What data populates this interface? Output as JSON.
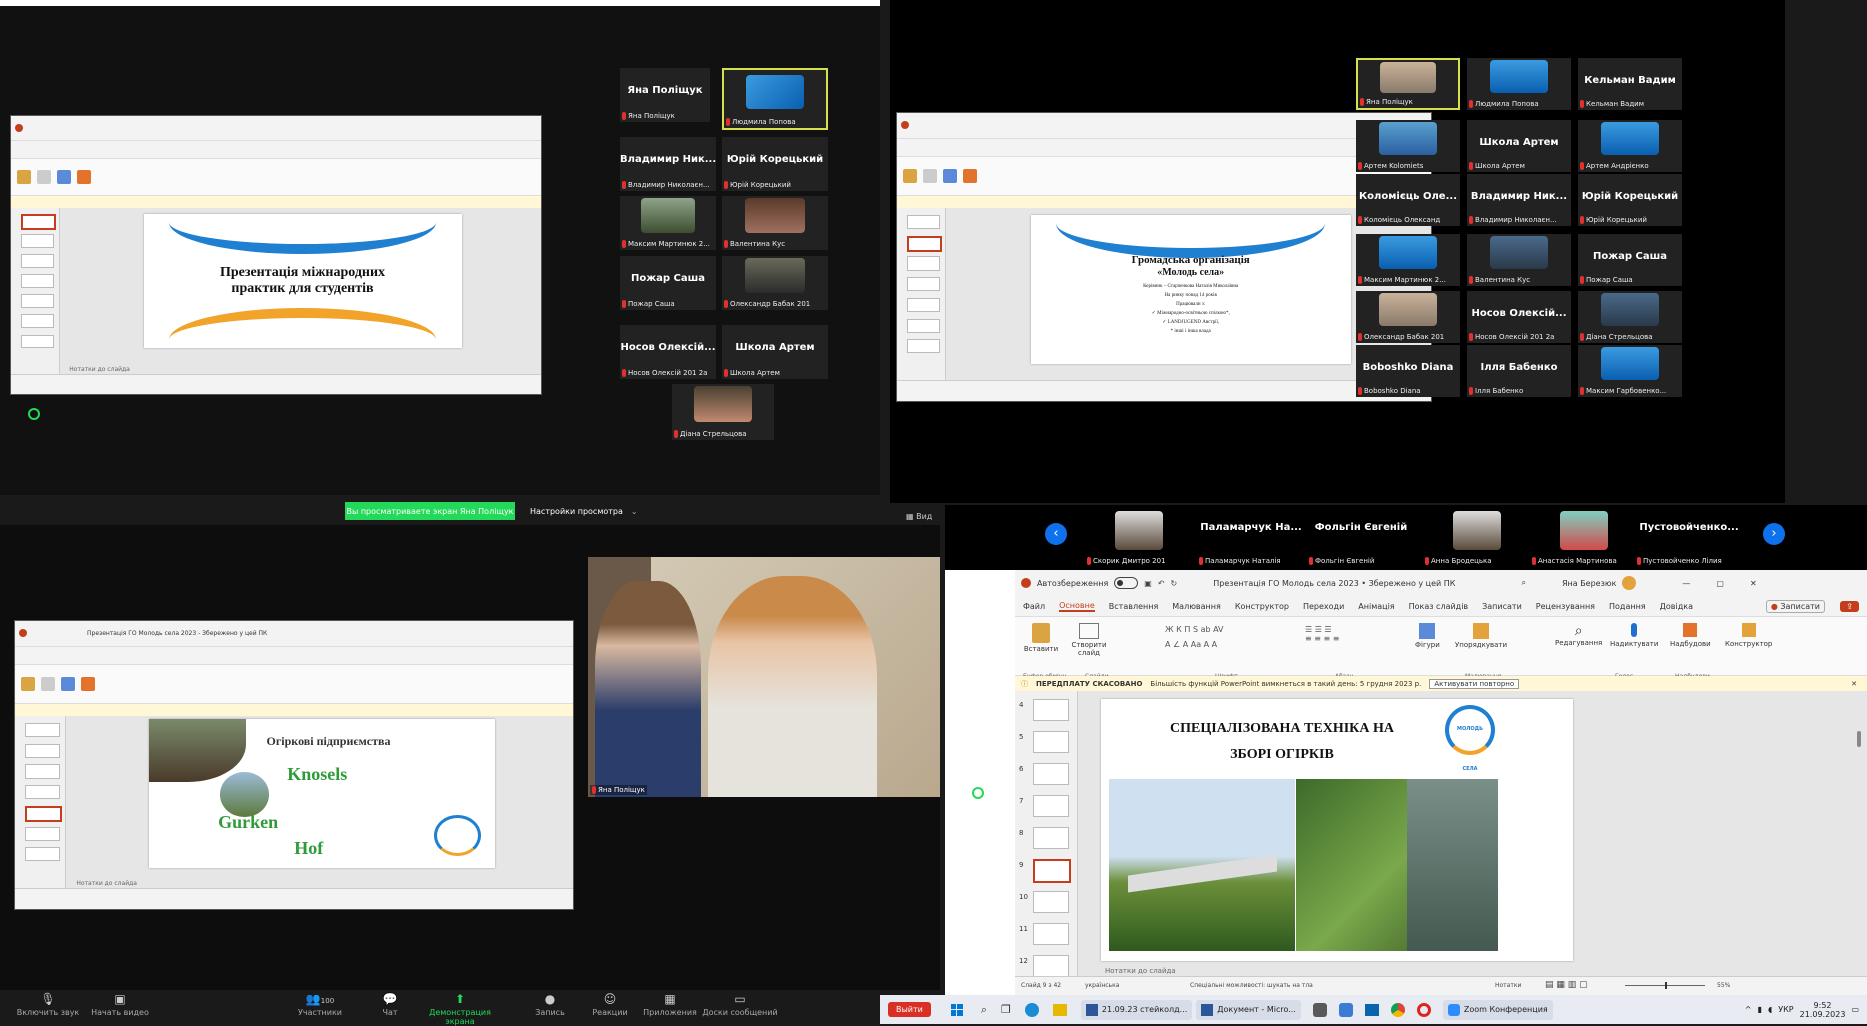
{
  "q1": {
    "tiles": [
      {
        "name": "Яна Поліщук",
        "caption": "Яна Поліщук"
      },
      {
        "caption": "Людмила Попова"
      },
      {
        "name": "Владимир Ник...",
        "caption": "Владимир Николаєн..."
      },
      {
        "name": "Юрій Корецький",
        "caption": "Юрій Корецький"
      },
      {
        "caption": "Максим Мартинюк 2..."
      },
      {
        "caption": "Валентина Кус"
      },
      {
        "name": "Пожар Саша",
        "caption": "Пожар Саша"
      },
      {
        "caption": "Олександр Бабак 201"
      },
      {
        "name": "Носов Олексій...",
        "caption": "Носов Олексій 201 2а"
      },
      {
        "name": "Школа Артем",
        "caption": "Школа Артем"
      },
      {
        "caption": "Діана Стрельцова"
      }
    ],
    "slide": {
      "title": "Презентація міжнародних практик для студентів"
    },
    "notes": "Нотатки до слайда"
  },
  "q2": {
    "tiles": [
      {
        "caption": "Яна Поліщук"
      },
      {
        "caption": "Людмила Попова"
      },
      {
        "name": "Кельман Вадим",
        "caption": "Кельман Вадим"
      },
      {
        "caption": "Артем Kolomiets"
      },
      {
        "name": "Школа Артем",
        "caption": "Школа Артем"
      },
      {
        "caption": "Артем Андрієнко"
      },
      {
        "name": "Коломієць Оле...",
        "caption": "Коломієць Олександ"
      },
      {
        "name": "Владимир Ник...",
        "caption": "Владимир Николаєн..."
      },
      {
        "name": "Юрій Корецький",
        "caption": "Юрій Корецький"
      },
      {
        "caption": "Максим Мартинюк 2..."
      },
      {
        "caption": "Валентина Кус"
      },
      {
        "name": "Пожар Саша",
        "caption": "Пожар Саша"
      },
      {
        "caption": "Олександр Бабак 201"
      },
      {
        "name": "Носов Олексій...",
        "caption": "Носов Олексій 201 2а"
      },
      {
        "caption": "Діана Стрельцова"
      },
      {
        "name": "Boboshko Diana",
        "caption": "Boboshko Diana"
      },
      {
        "name": "Ілля Бабенко",
        "caption": "Ілля Бабенко"
      },
      {
        "caption": "Максим Гарбовенко..."
      }
    ],
    "slide": {
      "title": "Громадська організація",
      "subtitle": "«Молодь села»",
      "lines": [
        "Керівник – Старченкова Наталія Миколаївна",
        "На ринку понад 14 років",
        "Працювали з:",
        "✓ Міжнародно-освітньою спілкою*,",
        "✓ LANDJUGEND Австрії,",
        "* інші і інша влада"
      ]
    }
  },
  "banner": {
    "viewing": "Вы просматриваете экран Яна Поліщук",
    "settings": "Настройки просмотра"
  },
  "q3": {
    "ppt_title": "Презентація ГО Молодь села 2023 - Збережено у цей ПК",
    "slide": {
      "title": "Огіркові підприємства",
      "brand1": "Knosels",
      "brand2": "Gurken",
      "brand3": "Hof"
    },
    "notes": "Нотатки до слайда",
    "camera_caption": "Яна Поліщук"
  },
  "q4": {
    "strip": [
      {
        "caption": "Скорик Дмитро 201"
      },
      {
        "name": "Паламарчук На...",
        "caption": "Паламарчук Наталія"
      },
      {
        "name": "Фольгін Євгеній",
        "caption": "Фольгін Євгеній"
      },
      {
        "caption": "Анна Бродецька"
      },
      {
        "caption": "Анастасія Мартинова"
      },
      {
        "name": "Пустовойченко...",
        "caption": "Пустовойченко Лілия"
      }
    ],
    "ppt": {
      "autosave": "Автозбереження",
      "doc_title": "Презентація ГО Молодь села 2023 • Збережено у цей ПК",
      "user": "Яна Березюк",
      "menu": [
        "Файл",
        "Основне",
        "Вставлення",
        "Малювання",
        "Конструктор",
        "Переходи",
        "Анімація",
        "Показ слайдів",
        "Записати",
        "Рецензування",
        "Подання",
        "Довідка"
      ],
      "record_btn": "Записати",
      "ribbon_groups": [
        "Буфер обміну",
        "Слайди",
        "Шрифт",
        "Абзац",
        "Малювання",
        "Голос",
        "Надбудови"
      ],
      "ribbon_buttons": [
        "Вставити",
        "Створити слайд",
        "Фігури",
        "Упорядкувати",
        "Редагування",
        "Надиктувати",
        "Надбудови",
        "Конструктор"
      ],
      "notice": "ПЕРЕДПЛАТУ СКАСОВАНО",
      "notice_text": "Більшість функцій PowerPoint вимкнеться в такий день: 5 грудня 2023 р.",
      "notice_btn": "Активувати повторно",
      "slide_title_1": "СПЕЦІАЛІЗОВАНА ТЕХНІКА НА",
      "slide_title_2": "ЗБОРІ ОГІРКІВ",
      "logo_text": "МОЛОДЬ СЕЛА",
      "thumb_numbers": [
        "4",
        "5",
        "6",
        "7",
        "8",
        "9",
        "10",
        "11",
        "12"
      ],
      "notes": "Нотатки до слайда",
      "status_left": "Слайд 9 з 42",
      "status_lang": "українська",
      "status_mid": "Спеціальні можливості: шукать на тла",
      "status_notes": "Нотатки",
      "zoom": "55%"
    }
  },
  "zoom_bar": [
    {
      "label": "Включить звук",
      "icon": "mic-muted-icon"
    },
    {
      "label": "Начать видео",
      "icon": "video-off-icon"
    },
    {
      "label": "Участники",
      "icon": "participants-icon",
      "count": "100"
    },
    {
      "label": "Чат",
      "icon": "chat-icon"
    },
    {
      "label": "Демонстрация экрана",
      "icon": "share-screen-icon"
    },
    {
      "label": "Запись",
      "icon": "record-icon"
    },
    {
      "label": "Реакции",
      "icon": "reactions-icon"
    },
    {
      "label": "Приложения",
      "icon": "apps-icon"
    },
    {
      "label": "Доски сообщений",
      "icon": "whiteboard-icon"
    }
  ],
  "exit_btn": "Выйти",
  "view_btn": "Вид",
  "taskbar": {
    "items": [
      "21.09.23 стейколд...",
      "Документ - Micro...",
      "Zoom Конференция"
    ],
    "lang": "УКР",
    "time": "9:52",
    "date": "21.09.2023"
  },
  "colors": {
    "zoom_green": "#23d959",
    "ppt_red": "#c43e1c",
    "zoom_blue": "#0e72ed"
  }
}
